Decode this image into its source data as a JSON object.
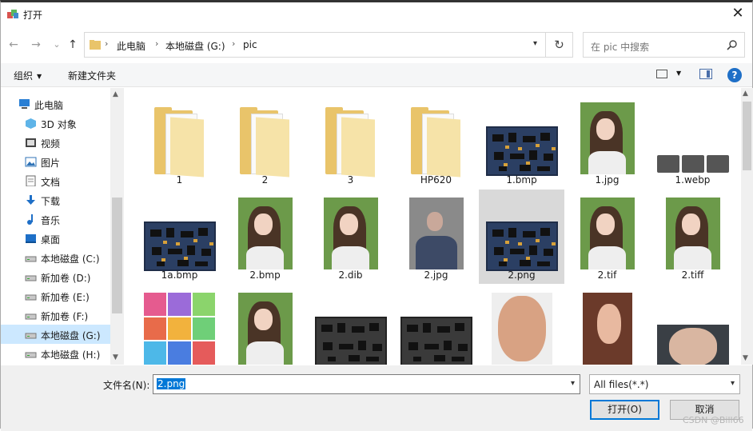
{
  "window": {
    "title": "打开",
    "close_glyph": "✕"
  },
  "nav": {
    "back_glyph": "←",
    "forward_glyph": "→",
    "recent_glyph": "⌄",
    "up_glyph": "↑",
    "breadcrumb": [
      "此电脑",
      "本地磁盘 (G:)",
      "pic"
    ],
    "refresh_glyph": "↻",
    "search_placeholder": "在 pic 中搜索"
  },
  "toolbar": {
    "organize": "组织",
    "new_folder": "新建文件夹",
    "help": "?"
  },
  "sidebar": {
    "items": [
      {
        "label": "此电脑",
        "icon": "computer-icon"
      },
      {
        "label": "3D 对象",
        "icon": "3d-objects-icon"
      },
      {
        "label": "视频",
        "icon": "video-icon"
      },
      {
        "label": "图片",
        "icon": "pictures-icon"
      },
      {
        "label": "文档",
        "icon": "documents-icon"
      },
      {
        "label": "下载",
        "icon": "download-icon"
      },
      {
        "label": "音乐",
        "icon": "music-icon"
      },
      {
        "label": "桌面",
        "icon": "desktop-icon"
      },
      {
        "label": "本地磁盘 (C:)",
        "icon": "drive-icon"
      },
      {
        "label": "新加卷 (D:)",
        "icon": "drive-icon"
      },
      {
        "label": "新加卷 (E:)",
        "icon": "drive-icon"
      },
      {
        "label": "新加卷 (F:)",
        "icon": "drive-icon"
      },
      {
        "label": "本地磁盘 (G:)",
        "icon": "drive-icon",
        "selected": true
      },
      {
        "label": "本地磁盘 (H:)",
        "icon": "drive-icon"
      }
    ]
  },
  "files": [
    {
      "name": "1",
      "kind": "folder"
    },
    {
      "name": "2",
      "kind": "folder"
    },
    {
      "name": "3",
      "kind": "folder"
    },
    {
      "name": "HP620",
      "kind": "folder"
    },
    {
      "name": "1.bmp",
      "kind": "pcb"
    },
    {
      "name": "1.jpg",
      "kind": "photo"
    },
    {
      "name": "1.webp",
      "kind": "strip"
    },
    {
      "name": "1a.bmp",
      "kind": "pcb"
    },
    {
      "name": "2.bmp",
      "kind": "photo"
    },
    {
      "name": "2.dib",
      "kind": "photo"
    },
    {
      "name": "2.jpg",
      "kind": "selfie"
    },
    {
      "name": "2.png",
      "kind": "pcb",
      "selected": true
    },
    {
      "name": "2.tif",
      "kind": "photo"
    },
    {
      "name": "2.tiff",
      "kind": "photo"
    },
    {
      "name": "",
      "kind": "palette"
    },
    {
      "name": "",
      "kind": "photo"
    },
    {
      "name": "",
      "kind": "pcbgray"
    },
    {
      "name": "",
      "kind": "pcbgray"
    },
    {
      "name": "",
      "kind": "face"
    },
    {
      "name": "",
      "kind": "portrait"
    },
    {
      "name": "",
      "kind": "eyes"
    }
  ],
  "bottom": {
    "filename_label": "文件名(N):",
    "filename_value": "2.png",
    "filetype_value": "All files(*.*)",
    "open_button": "打开(O)",
    "cancel_button": "取消",
    "watermark": "CSDN @Bill66"
  },
  "colors": {
    "accent": "#0078d7",
    "selection": "#cce8ff",
    "folder": "#e9c46a"
  }
}
